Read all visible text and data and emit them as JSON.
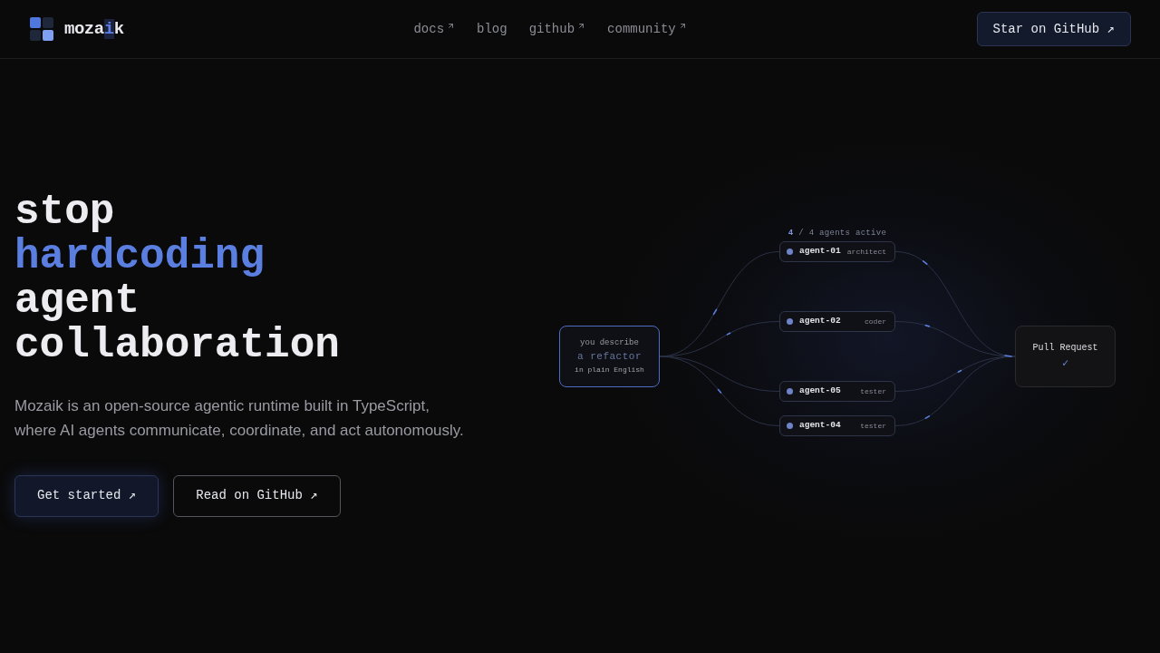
{
  "header": {
    "logo": {
      "parts": [
        {
          "text": "moza",
          "accent": false
        },
        {
          "text": "i",
          "accent": true
        },
        {
          "text": "k",
          "accent": false
        }
      ]
    },
    "nav": [
      {
        "label": "docs",
        "external": true
      },
      {
        "label": "blog",
        "external": false
      },
      {
        "label": "github",
        "external": true
      },
      {
        "label": "community",
        "external": true
      }
    ],
    "cta": {
      "label": "Star on GitHub ↗"
    }
  },
  "hero": {
    "headline": [
      {
        "text": "stop",
        "accent": false
      },
      {
        "text": "hardcoding",
        "accent": true
      },
      {
        "text": "agent",
        "accent": false
      },
      {
        "text": "collaboration",
        "accent": false
      }
    ],
    "description": "Mozaik is an open-source agentic runtime built in TypeScript, where AI agents communicate, coordinate, and act autonomously.",
    "buttons": [
      {
        "label": "Get started ↗",
        "kind": "primary"
      },
      {
        "label": "Read on GitHub ↗",
        "kind": "secondary"
      }
    ]
  },
  "diagram": {
    "status": {
      "active": "4",
      "rest": "/ 4 agents active"
    },
    "source": {
      "caption": "you describe",
      "task": "a refactor",
      "note": "in plain English"
    },
    "agents": [
      {
        "name": "agent-01",
        "role": "architect"
      },
      {
        "name": "agent-02",
        "role": "coder"
      },
      {
        "name": "agent-05",
        "role": "tester"
      },
      {
        "name": "agent-04",
        "role": "tester"
      }
    ],
    "output": {
      "label": "Pull Request",
      "mark": "✓"
    }
  }
}
